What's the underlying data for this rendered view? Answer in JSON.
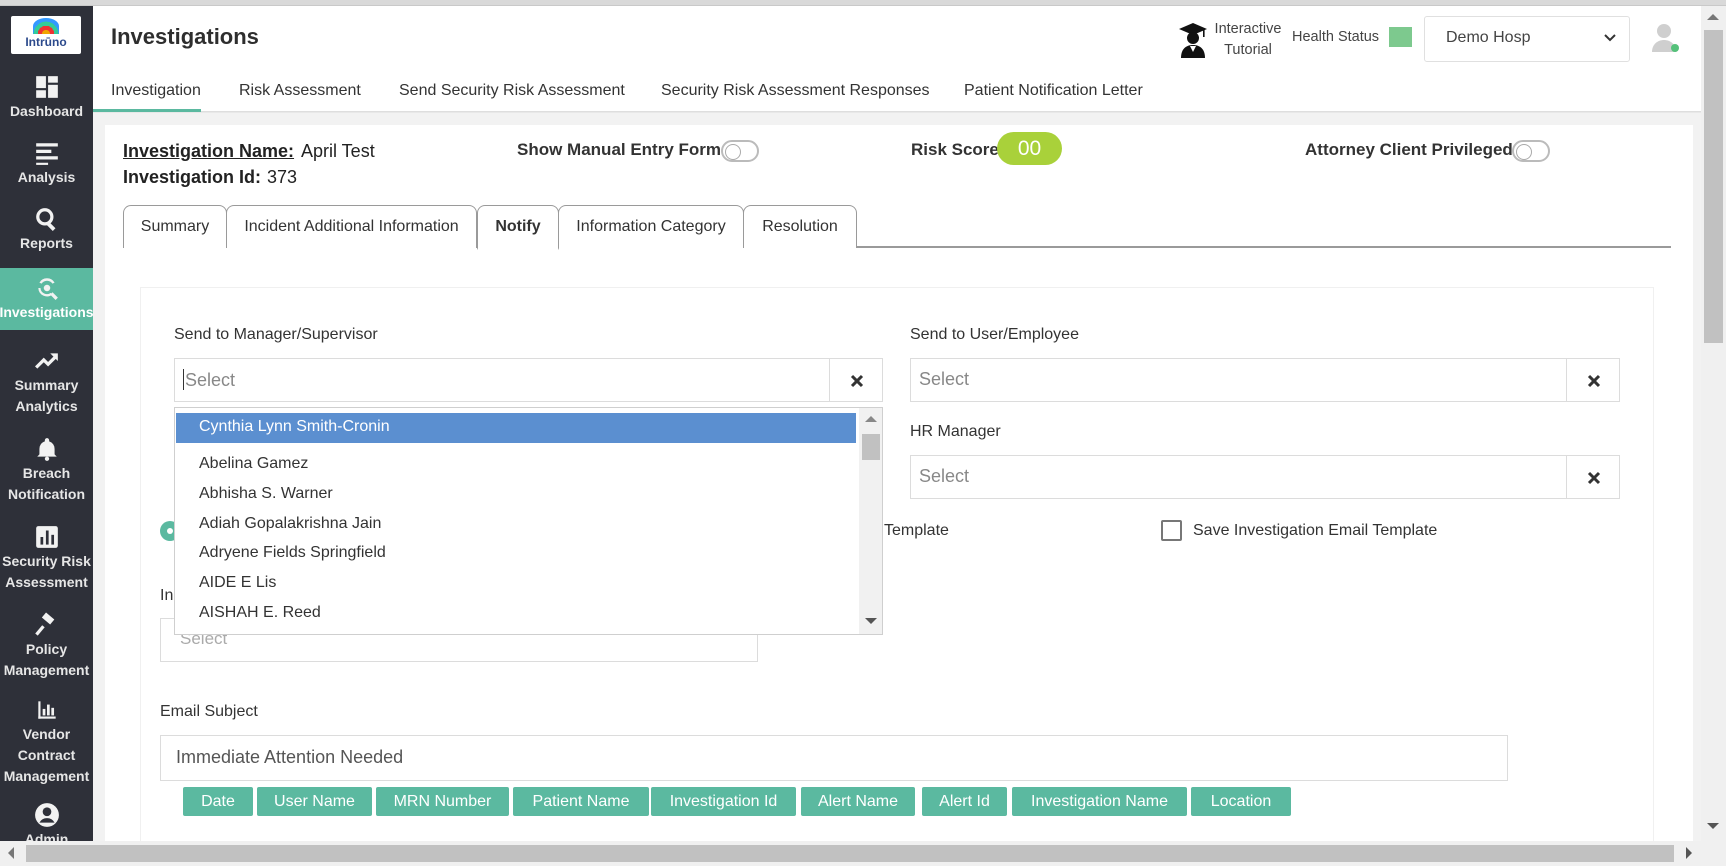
{
  "app": {
    "logo_text": "Intrūno",
    "page_title": "Investigations"
  },
  "header": {
    "tutorial_line1": "Interactive",
    "tutorial_line2": "Tutorial",
    "health_label": "Health Status",
    "health_color": "#7dc98e",
    "hospital": "Demo Hosp"
  },
  "sidebar": {
    "items": [
      {
        "label": "Dashboard",
        "icon": "dashboard-icon"
      },
      {
        "label": "Analysis",
        "icon": "analysis-icon"
      },
      {
        "label": "Reports",
        "icon": "search-icon"
      },
      {
        "label": "Investigations",
        "icon": "investigations-icon",
        "active": true
      },
      {
        "label_line1": "Summary",
        "label_line2": "Analytics",
        "icon": "trend-icon"
      },
      {
        "label_line1": "Breach",
        "label_line2": "Notification",
        "icon": "bell-icon"
      },
      {
        "label_line1": "Security Risk",
        "label_line2": "Assessment",
        "icon": "bar-chart-icon"
      },
      {
        "label_line1": "Policy",
        "label_line2": "Management",
        "icon": "gavel-icon"
      },
      {
        "label_line1": "Vendor",
        "label_line2": "Contract",
        "label_line3": "Management",
        "icon": "chart-icon"
      },
      {
        "label": "Admin",
        "icon": "user-circle-icon"
      }
    ]
  },
  "toptabs": [
    {
      "label": "Investigation",
      "active": true
    },
    {
      "label": "Risk Assessment"
    },
    {
      "label": "Send Security Risk Assessment"
    },
    {
      "label": "Security Risk Assessment Responses"
    },
    {
      "label": "Patient Notification Letter"
    }
  ],
  "investigation": {
    "name_label": "Investigation Name:",
    "name_value": "April Test",
    "id_label": "Investigation Id:",
    "id_value": "373",
    "manual_entry_label": "Show Manual Entry Form",
    "risk_label": "Risk Score",
    "risk_value": "00",
    "risk_color": "#a9d13a",
    "attorney_label": "Attorney Client Privileged :"
  },
  "inner_tabs": [
    {
      "label": "Summary"
    },
    {
      "label": "Incident Additional Information"
    },
    {
      "label": "Notify",
      "active": true
    },
    {
      "label": "Information Category"
    },
    {
      "label": "Resolution"
    }
  ],
  "notify": {
    "manager_label": "Send to Manager/Supervisor",
    "manager_placeholder": "Select",
    "user_label": "Send to User/Employee",
    "user_placeholder": "Select",
    "hr_label": "HR Manager",
    "hr_placeholder": "Select",
    "template_partial": "Template",
    "save_template_label": "Save Investigation Email Template",
    "in_label_partial": "In",
    "in_placeholder": "Select",
    "email_subject_label": "Email Subject",
    "email_subject_value": "Immediate Attention Needed",
    "chips": [
      "Date",
      "User Name",
      "MRN Number",
      "Patient Name",
      "Investigation Id",
      "Alert Name",
      "Alert Id",
      "Investigation Name",
      "Location"
    ]
  },
  "dropdown": {
    "options": [
      "Cynthia Lynn Smith-Cronin",
      "Abelina Gamez",
      "Abhisha S. Warner",
      "Adiah Gopalakrishna Jain",
      "Adryene Fields Springfield",
      "AIDE E Lis",
      "AISHAH E. Reed"
    ],
    "highlighted_index": 0
  },
  "colors": {
    "accent": "#5bb9a0",
    "sidebar_bg": "#2e3039",
    "dropdown_highlight": "#5b8fd0"
  }
}
